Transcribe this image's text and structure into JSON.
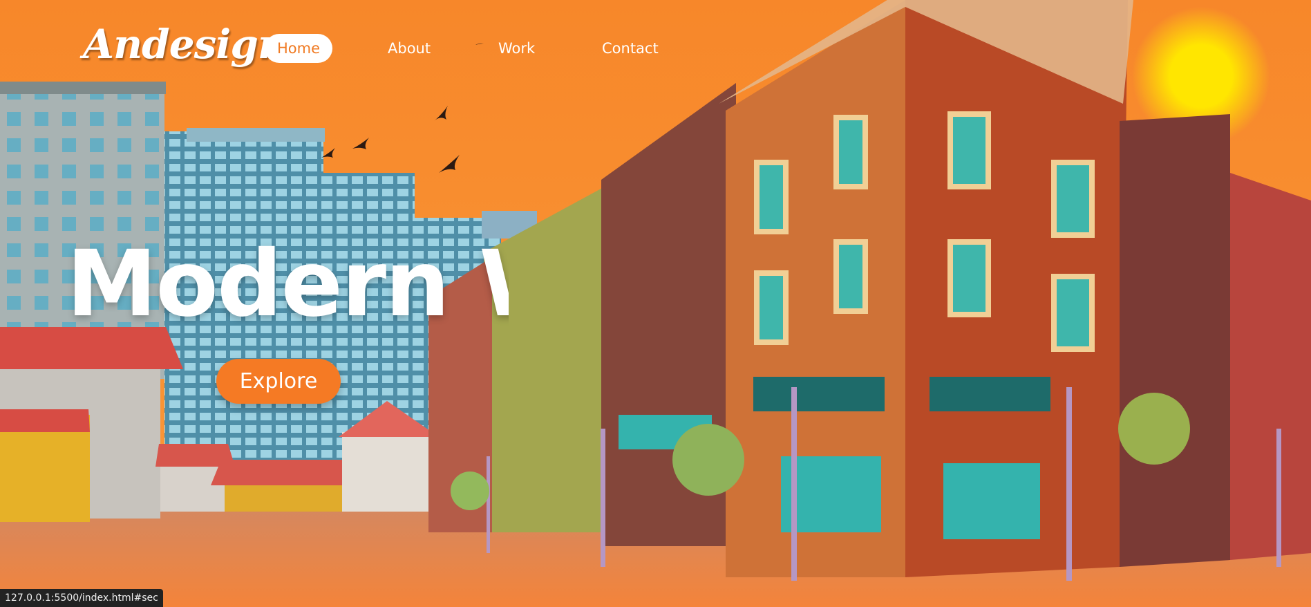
{
  "brand": {
    "logo": "Andesign"
  },
  "nav": {
    "items": [
      {
        "label": "Home",
        "active": true
      },
      {
        "label": "About",
        "active": false
      },
      {
        "label": "Work",
        "active": false
      },
      {
        "label": "Contact",
        "active": false
      }
    ]
  },
  "hero": {
    "title": "Modern W",
    "cta_label": "Explore"
  },
  "status_bar": {
    "url": "127.0.0.1:5500/index.html#sec"
  },
  "colors": {
    "sky": "#f8892c",
    "accent": "#f57a24",
    "nav_active_bg": "#ffffff",
    "sun": "#ffe600",
    "text": "#ffffff"
  }
}
